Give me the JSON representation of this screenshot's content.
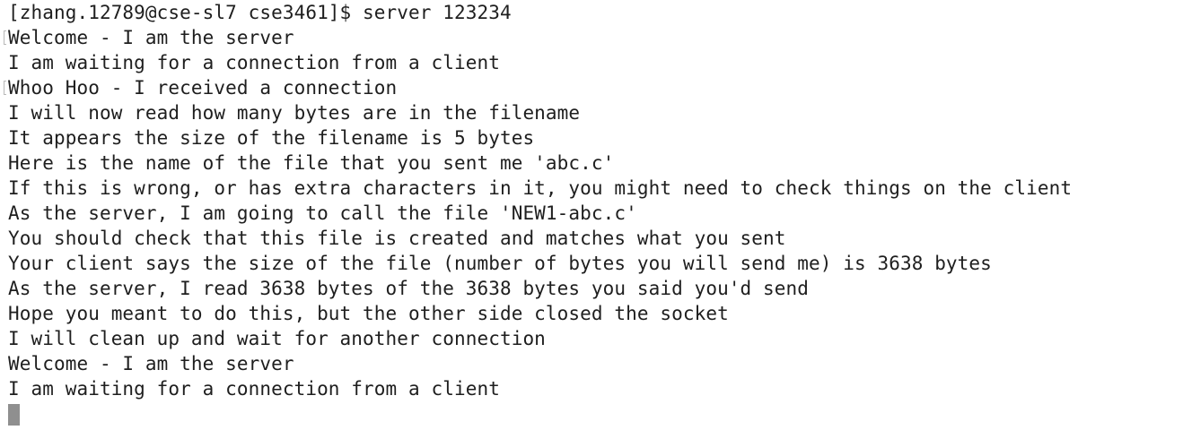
{
  "terminal": {
    "prompt": "[zhang.12789@cse-sl7 cse3461]$ server 123234",
    "output_lines": [
      "Welcome - I am the server",
      "I am waiting for a connection from a client",
      "Whoo Hoo - I received a connection",
      "I will now read how many bytes are in the filename",
      "It appears the size of the filename is 5 bytes",
      "Here is the name of the file that you sent me 'abc.c'",
      "If this is wrong, or has extra characters in it, you might need to check things on the client",
      "As the server, I am going to call the file 'NEW1-abc.c'",
      "You should check that this file is created and matches what you sent",
      "Your client says the size of the file (number of bytes you will send me) is 3638 bytes",
      "As the server, I read 3638 bytes of the 3638 bytes you said you'd send",
      "Hope you meant to do this, but the other side closed the socket",
      "I will clean up and wait for another connection",
      "Welcome - I am the server",
      "I am waiting for a connection from a client"
    ],
    "colors": {
      "background": "#ffffff",
      "text": "#1e1e1e",
      "cursor": "#8f8f8f"
    }
  }
}
